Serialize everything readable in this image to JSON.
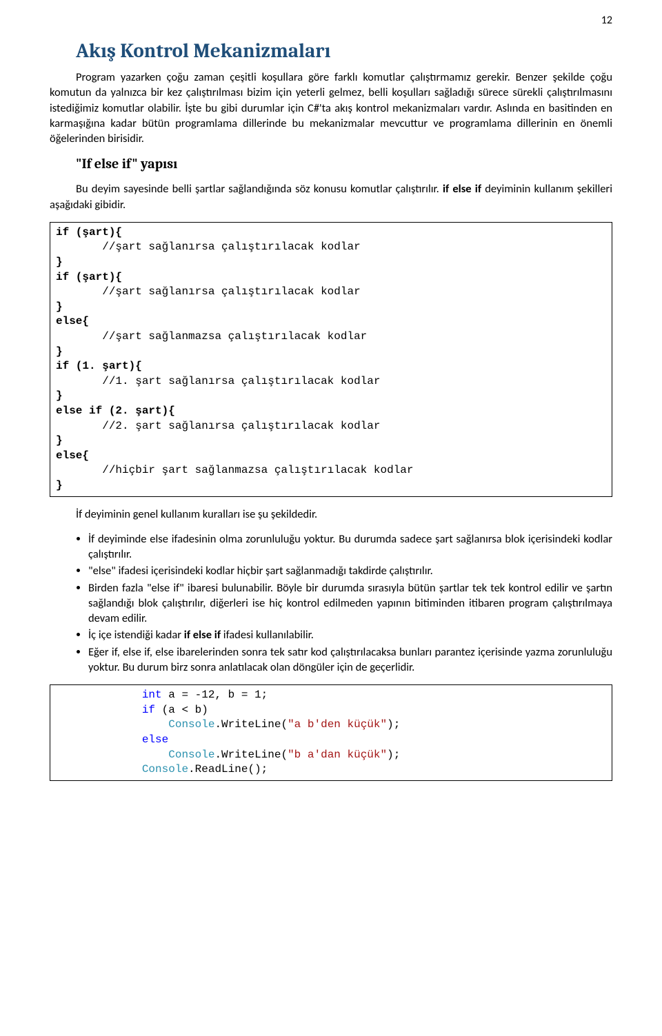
{
  "page_number": "12",
  "title": "Akış Kontrol Mekanizmaları",
  "intro": "Program yazarken çoğu zaman çeşitli koşullara göre farklı komutlar çalıştırmamız gerekir. Benzer şekilde çoğu komutun da yalnızca bir kez çalıştırılması bizim için yeterli gelmez, belli koşulları sağladığı sürece sürekli çalıştırılmasını istediğimiz komutlar olabilir. İşte bu gibi durumlar için C#'ta akış kontrol mekanizmaları vardır. Aslında en basitinden en karmaşığına kadar bütün programlama dillerinde bu mekanizmalar mevcuttur ve programlama dillerinin en önemli öğelerinden birisidir.",
  "subtitle": "\"If else if\" yapısı",
  "subpara_a": "Bu deyim sayesinde belli şartlar sağlandığında söz konusu komutlar çalıştırılır. ",
  "subpara_b": "if else if",
  "subpara_c": " deyiminin kullanım şekilleri aşağıdaki gibidir.",
  "code1": {
    "l1": "if (şart){",
    "l2": "       //şart sağlanırsa çalıştırılacak kodlar",
    "l3": "}",
    "l4": "if (şart){",
    "l5": "       //şart sağlanırsa çalıştırılacak kodlar",
    "l6": "}",
    "l7": "else{",
    "l8": "       //şart sağlanmazsa çalıştırılacak kodlar",
    "l9": "}",
    "l10": "if (1. şart){",
    "l11": "       //1. şart sağlanırsa çalıştırılacak kodlar",
    "l12": "}",
    "l13": "else if (2. şart){",
    "l14": "       //2. şart sağlanırsa çalıştırılacak kodlar",
    "l15": "}",
    "l16": "else{",
    "l17": "       //hiçbir şart sağlanmazsa çalıştırılacak kodlar",
    "l18": "}"
  },
  "rules_heading": "İf deyiminin genel kullanım kuralları ise şu şekildedir.",
  "bullets": {
    "b1": "İf deyiminde else ifadesinin olma zorunluluğu yoktur. Bu durumda sadece şart sağlanırsa blok içerisindeki kodlar çalıştırılır.",
    "b2": "\"else\" ifadesi içerisindeki kodlar hiçbir şart sağlanmadığı takdirde çalıştırılır.",
    "b3": "Birden fazla \"else if\" ibaresi bulunabilir. Böyle bir durumda sırasıyla bütün şartlar tek tek kontrol edilir ve şartın sağlandığı blok çalıştırılır, diğerleri ise hiç kontrol edilmeden yapının bitiminden itibaren program çalıştırılmaya devam edilir.",
    "b4a": "İç içe istendiği kadar ",
    "b4b": "if else if",
    "b4c": " ifadesi kullanılabilir.",
    "b5": "Eğer if, else if, else ibarelerinden sonra tek satır kod çalıştırılacaksa bunları parantez içerisinde yazma zorunluluğu yoktur. Bu durum birz sonra anlatılacak olan döngüler için de geçerlidir."
  },
  "code2": {
    "l1a": "             ",
    "l1b": "int",
    "l1c": " a = -12, b = 1;",
    "l2a": "             ",
    "l2b": "if",
    "l2c": " (a < b)",
    "l3a": "                 ",
    "l3b": "Console",
    "l3c": ".WriteLine(",
    "l3d": "\"a b'den küçük\"",
    "l3e": ");",
    "l4a": "             ",
    "l4b": "else",
    "l5a": "                 ",
    "l5b": "Console",
    "l5c": ".WriteLine(",
    "l5d": "\"b a'dan küçük\"",
    "l5e": ");",
    "l6a": "             ",
    "l6b": "Console",
    "l6c": ".ReadLine();"
  }
}
